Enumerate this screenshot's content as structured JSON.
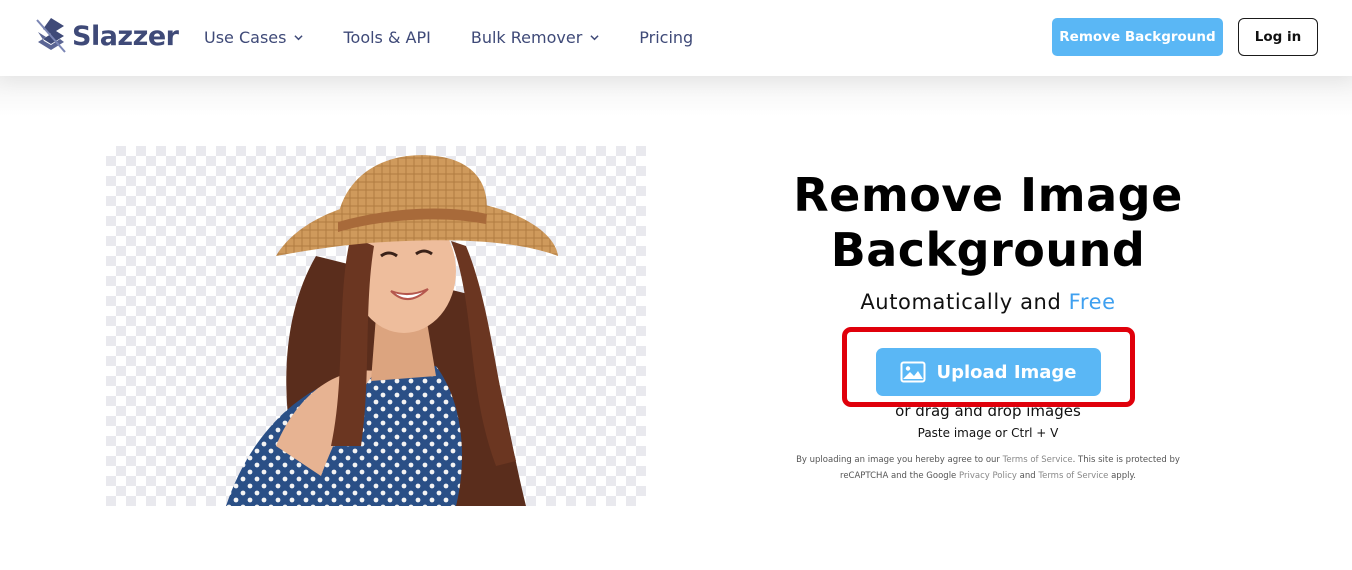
{
  "header": {
    "logo_text": "Slazzer",
    "nav": [
      {
        "label": "Use Cases",
        "has_dropdown": true
      },
      {
        "label": "Tools & API",
        "has_dropdown": false
      },
      {
        "label": "Bulk Remover",
        "has_dropdown": true
      },
      {
        "label": "Pricing",
        "has_dropdown": false
      }
    ],
    "cta_label": "Remove Background",
    "login_label": "Log in"
  },
  "hero": {
    "title_line1": "Remove Image",
    "title_line2": "Background",
    "subtitle_prefix": "Automatically and",
    "subtitle_highlight": "Free",
    "upload_label": "Upload Image",
    "drag_text": "or drag and drop images",
    "paste_text": "Paste image or Ctrl + V",
    "legal": {
      "part1": "By uploading an image you hereby agree to our",
      "terms_link": "Terms of Service",
      "part2": ". This site is protected by reCAPTCHA and the Google",
      "privacy_link": "Privacy Policy",
      "part3": "and",
      "terms_link2": "Terms of Service",
      "part4": "apply."
    }
  },
  "colors": {
    "accent": "#5ab7f5",
    "brand": "#3f4a78",
    "highlight_border": "#e0000b",
    "free_text": "#3fa0f0"
  },
  "icons": {
    "logo": "slazzer-logo-icon",
    "dropdown": "chevron-down-icon",
    "upload": "image-icon"
  }
}
